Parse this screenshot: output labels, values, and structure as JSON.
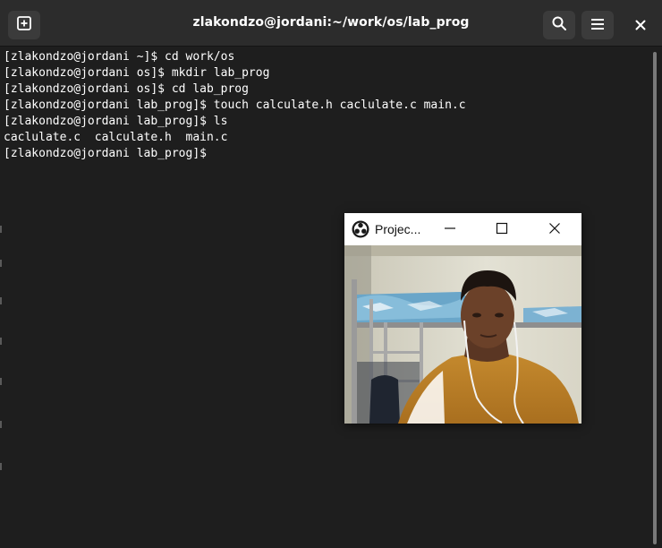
{
  "window": {
    "title": "zlakondzo@jordani:~/work/os/lab_prog",
    "background": "#1e1e1e",
    "titlebar_background": "#2c2c2c"
  },
  "toolbar": {
    "new_tab_icon": "new-tab-icon",
    "search_icon": "search-icon",
    "menu_icon": "hamburger-menu-icon",
    "close_icon": "close-icon"
  },
  "terminal": {
    "lines": [
      "[zlakondzo@jordani ~]$ cd work/os",
      "[zlakondzo@jordani os]$ mkdir lab_prog",
      "[zlakondzo@jordani os]$ cd lab_prog",
      "[zlakondzo@jordani lab_prog]$ touch calculate.h caclulate.c main.c",
      "[zlakondzo@jordani lab_prog]$ ls",
      "caclulate.c  calculate.h  main.c",
      "[zlakondzo@jordani lab_prog]$"
    ],
    "text_color": "#ffffff"
  },
  "projector": {
    "title": "Projec...",
    "logo_icon": "obs-logo-icon",
    "minimize_icon": "minimize-icon",
    "maximize_icon": "maximize-icon",
    "close_icon": "close-icon",
    "content": "webcam-video-feed"
  }
}
